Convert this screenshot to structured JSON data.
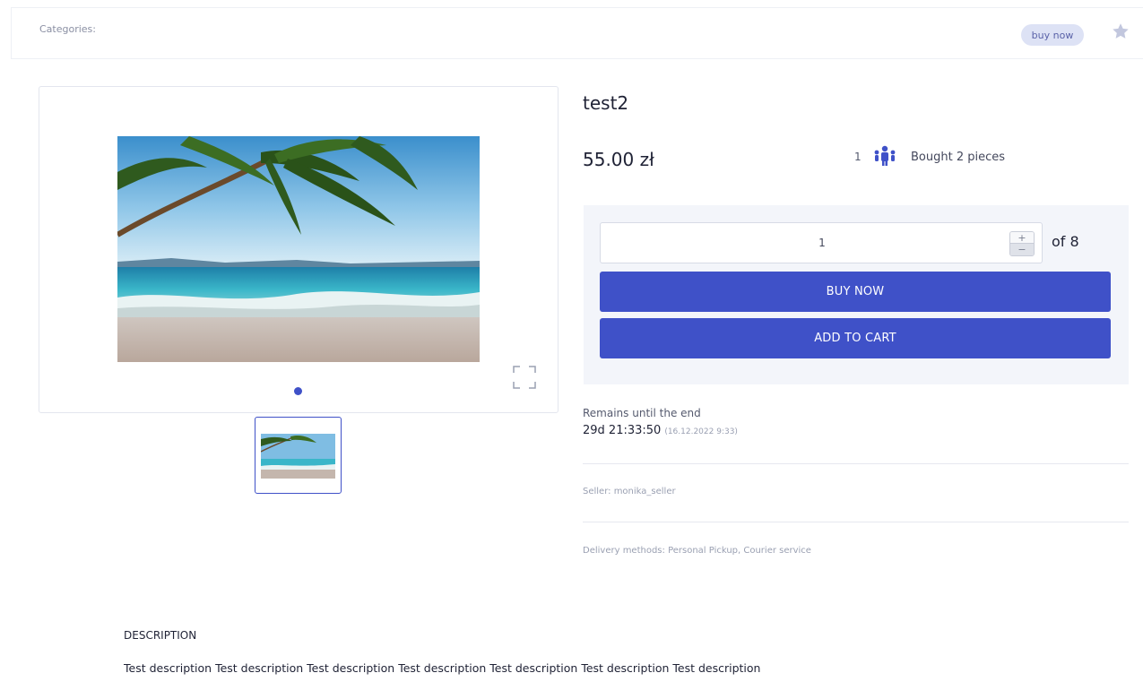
{
  "header": {
    "categories_label": "Categories:",
    "buy_now_badge": "buy now"
  },
  "product": {
    "title": "test2",
    "price": "55.00 zł",
    "buyers_count": "1",
    "bought_text": "Bought 2 pieces"
  },
  "purchase": {
    "quantity_value": "1",
    "stepper_plus": "+",
    "stepper_minus": "−",
    "of_label": "of 8",
    "buy_now_label": "BUY NOW",
    "add_to_cart_label": "ADD TO CART"
  },
  "auction": {
    "remains_label": "Remains until the end",
    "countdown": "29d 21:33:50",
    "end_date": "(16.12.2022 9:33)"
  },
  "details": {
    "seller": "Seller:  monika_seller",
    "delivery": "Delivery methods:  Personal Pickup,  Courier service"
  },
  "description": {
    "heading": "DESCRIPTION",
    "text": "Test description Test description Test description Test description Test description Test description Test description"
  },
  "icons": {
    "favorite": "star-icon",
    "buyers": "people-icon",
    "fullscreen": "fullscreen-icon"
  },
  "colors": {
    "accent": "#3f51c8",
    "badge_bg": "#dde2f5",
    "panel_bg": "#f3f5fa"
  }
}
